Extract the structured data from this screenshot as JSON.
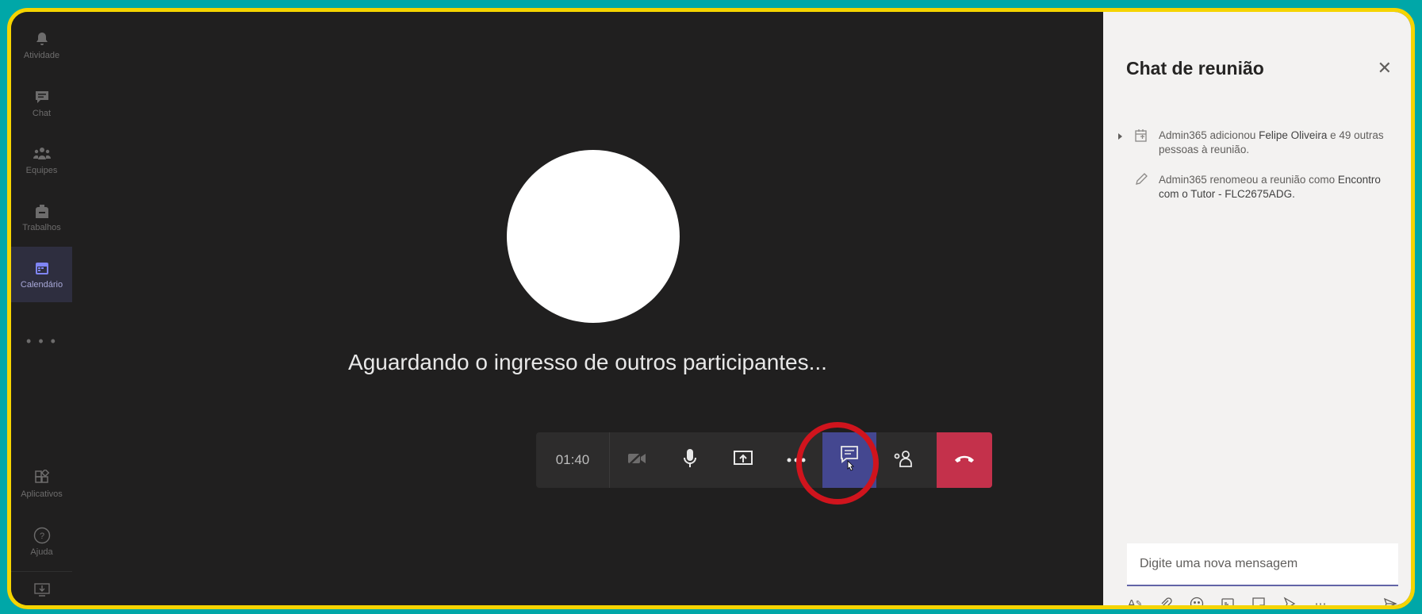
{
  "rail": {
    "items": [
      {
        "label": "Atividade",
        "icon": "bell-icon"
      },
      {
        "label": "Chat",
        "icon": "chat-icon"
      },
      {
        "label": "Equipes",
        "icon": "teams-icon"
      },
      {
        "label": "Trabalhos",
        "icon": "backpack-icon"
      },
      {
        "label": "Calendário",
        "icon": "calendar-icon"
      },
      {
        "label": "Aplicativos",
        "icon": "apps-icon"
      },
      {
        "label": "Ajuda",
        "icon": "help-icon"
      }
    ],
    "more": "• • •"
  },
  "stage": {
    "waiting_text": "Aguardando o ingresso de outros participantes..."
  },
  "toolbar": {
    "timer": "01:40",
    "buttons": [
      "camera-off-icon",
      "microphone-icon",
      "share-screen-icon",
      "more-icon",
      "chat-icon",
      "participants-icon",
      "hang-up-icon"
    ]
  },
  "chat": {
    "title": "Chat de reunião",
    "close": "✕",
    "messages": [
      {
        "pre": "Admin365 adicionou ",
        "bold": "Felipe Oliveira",
        "post": " e 49 outras pessoas à reunião."
      },
      {
        "pre": "Admin365 renomeou a reunião como ",
        "bold": "Encontro com o Tutor - FLC2675ADG.",
        "post": ""
      }
    ],
    "compose_placeholder": "Digite uma nova mensagem"
  },
  "colors": {
    "accent": "#6264a7",
    "hangup": "#c4314b",
    "highlight_ring": "#d0141d",
    "frame": "#f5d400",
    "background": "#00a7a8"
  }
}
